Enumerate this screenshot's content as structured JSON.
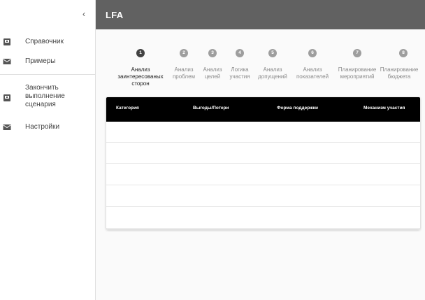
{
  "sidebar": {
    "collapse_icon": "‹",
    "items": [
      {
        "label": "Справочник",
        "icon": "book-icon"
      },
      {
        "label": "Примеры",
        "icon": "mail-icon"
      },
      {
        "label": "Закончить выполнение сценария",
        "icon": "save-icon"
      },
      {
        "label": "Настройки",
        "icon": "mail-icon"
      }
    ]
  },
  "header": {
    "title": "LFA"
  },
  "stepper": {
    "steps": [
      {
        "number": "1",
        "label": "Анализ заинтересованых сторон",
        "active": true
      },
      {
        "number": "2",
        "label": "Анализ проблем",
        "active": false
      },
      {
        "number": "3",
        "label": "Анализ целей",
        "active": false
      },
      {
        "number": "4",
        "label": "Логика участия",
        "active": false
      },
      {
        "number": "5",
        "label": "Анализ допущений",
        "active": false
      },
      {
        "number": "6",
        "label": "Анализ показателей",
        "active": false
      },
      {
        "number": "7",
        "label": "Планирование мероприятий",
        "active": false
      },
      {
        "number": "8",
        "label": "Планирование бюджета",
        "active": false
      }
    ]
  },
  "table": {
    "columns": [
      "Категория",
      "Выгоды/Потери",
      "Форма поддержки",
      "Механизм участия"
    ],
    "rows": [
      [
        "",
        "",
        "",
        ""
      ],
      [
        "",
        "",
        "",
        ""
      ],
      [
        "",
        "",
        "",
        ""
      ],
      [
        "",
        "",
        "",
        ""
      ],
      [
        "",
        "",
        "",
        ""
      ]
    ]
  },
  "colors": {
    "appbar": "#616161",
    "step_active": "#424242",
    "step_inactive": "#9e9e9e",
    "table_header": "#000000"
  }
}
